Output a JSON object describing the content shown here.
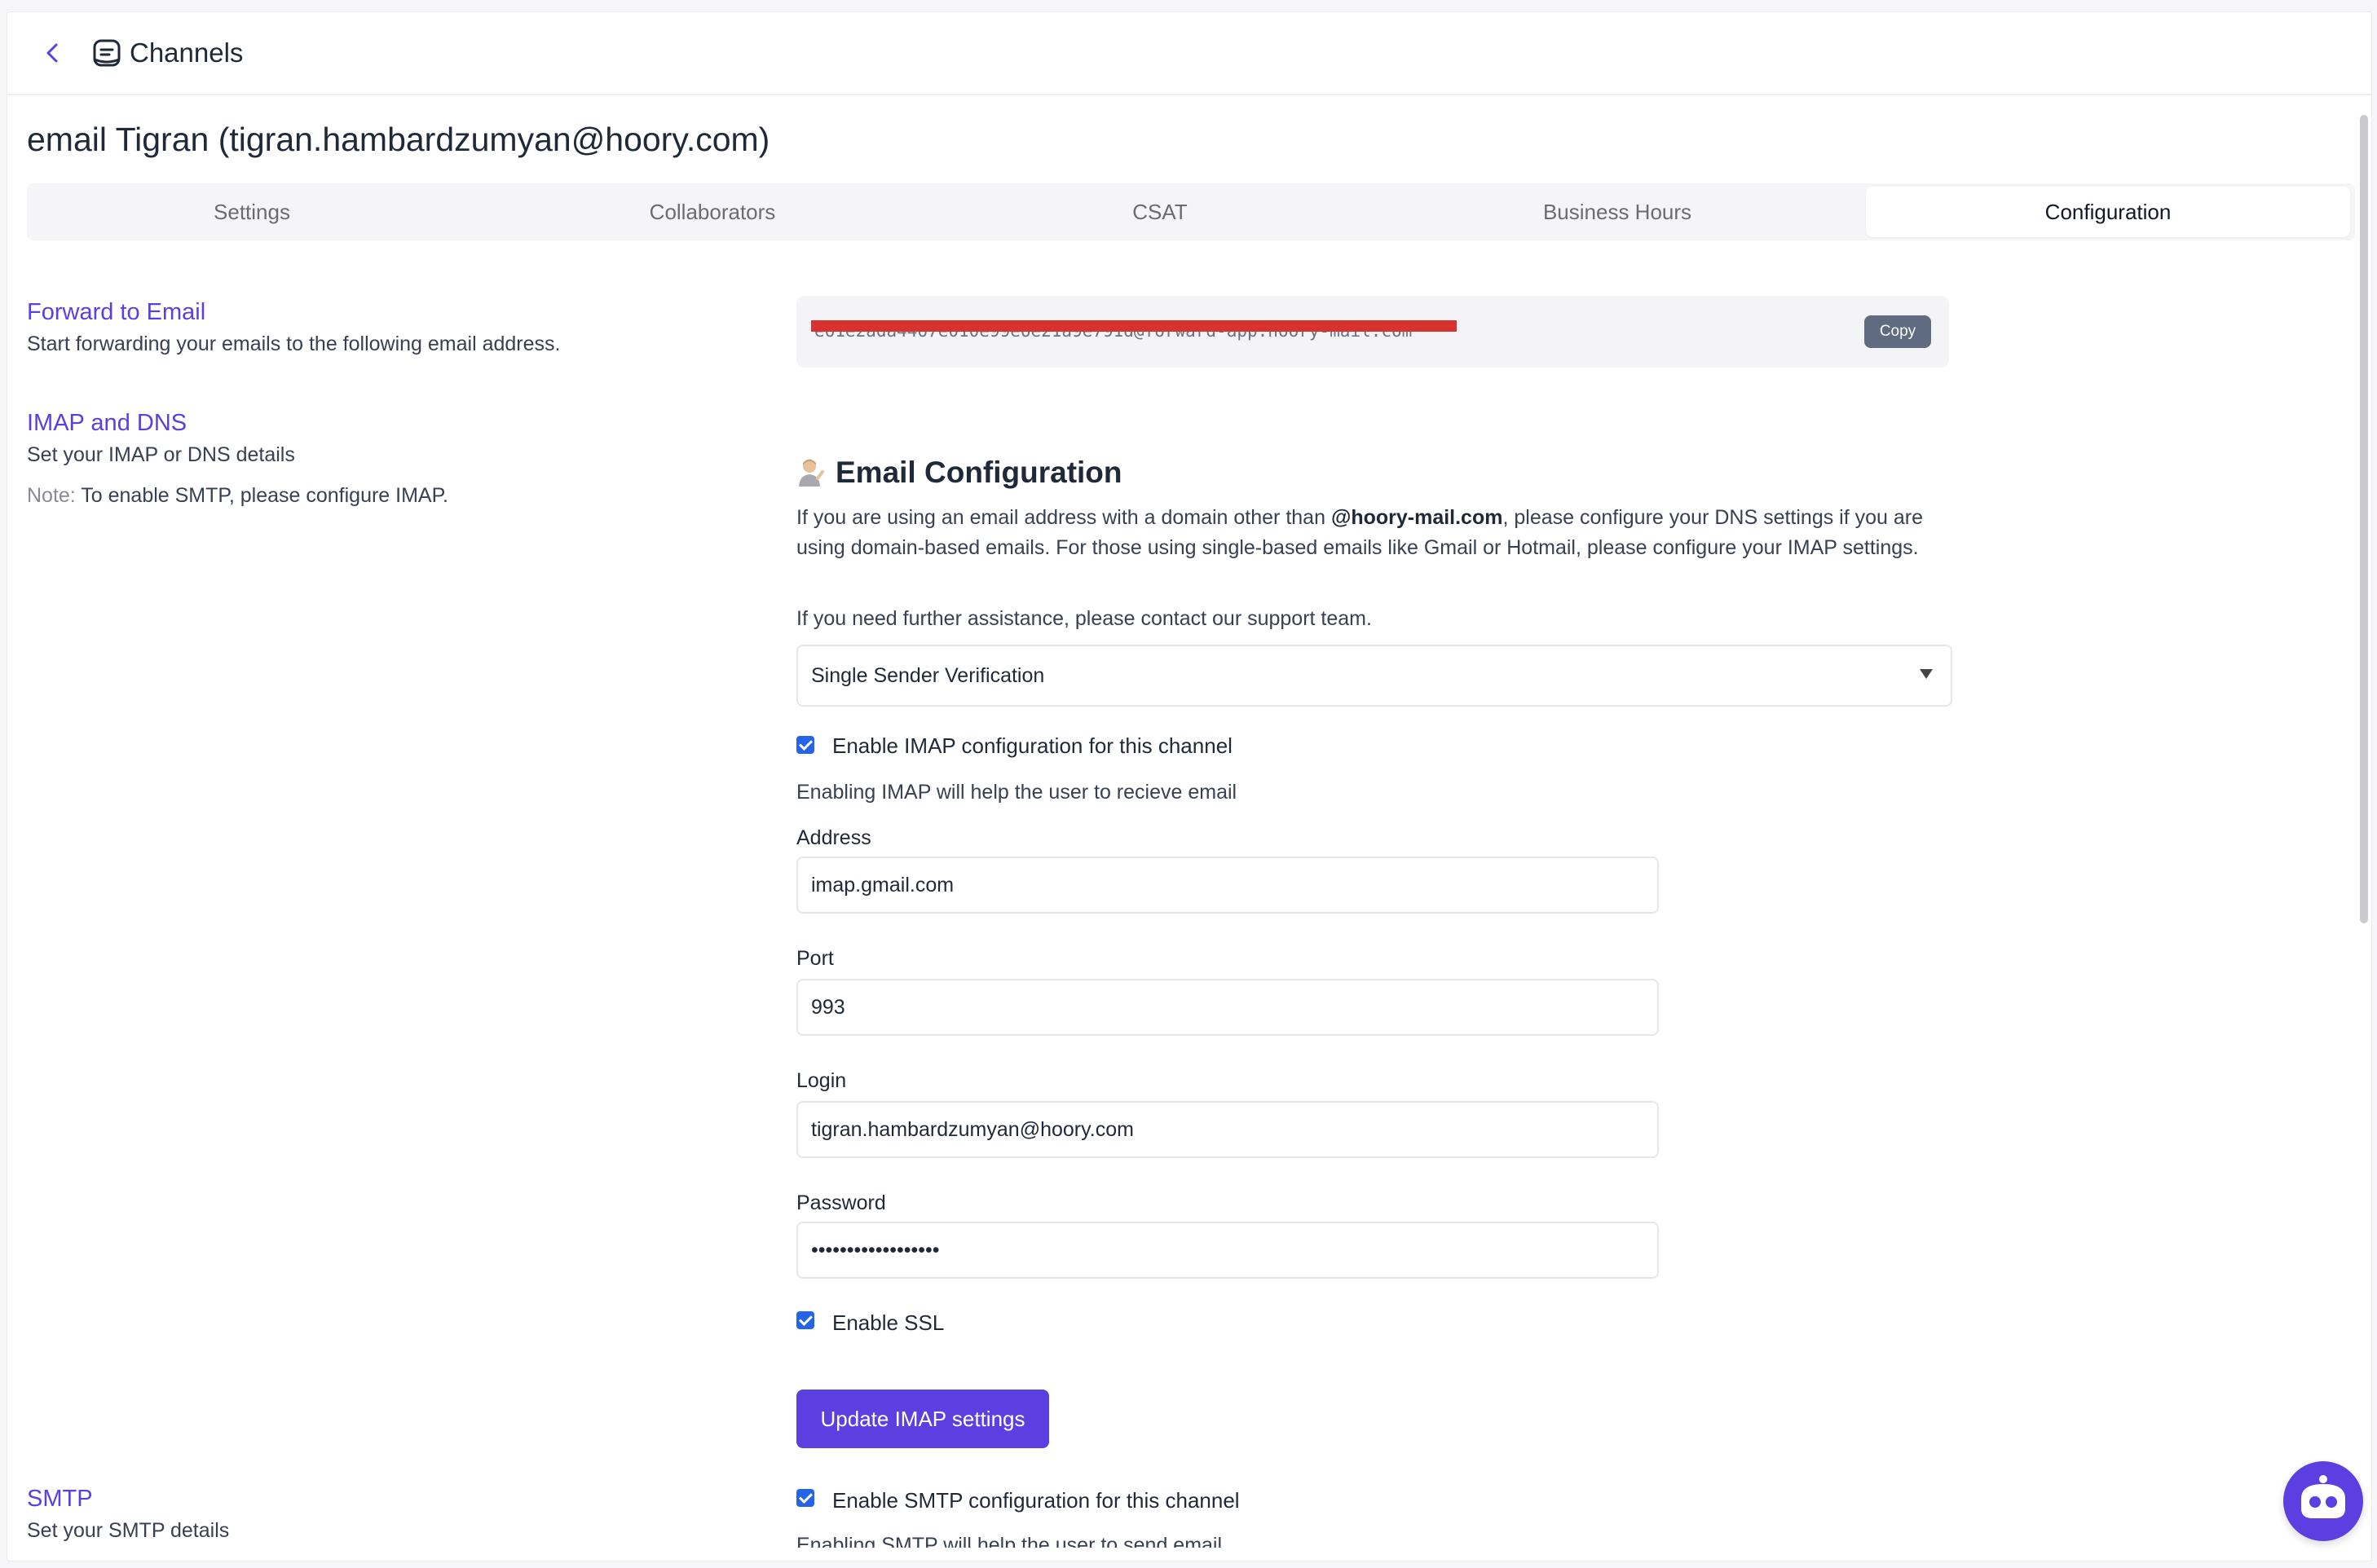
{
  "header": {
    "breadcrumb_title": "Channels"
  },
  "page": {
    "title": "email Tigran (tigran.hambardzumyan@hoory.com)"
  },
  "tabs": [
    {
      "label": "Settings",
      "active": false
    },
    {
      "label": "Collaborators",
      "active": false
    },
    {
      "label": "CSAT",
      "active": false
    },
    {
      "label": "Business Hours",
      "active": false
    },
    {
      "label": "Configuration",
      "active": true
    }
  ],
  "sidebar": {
    "forward": {
      "title": "Forward to Email",
      "desc": "Start forwarding your emails to the following email address."
    },
    "imap": {
      "title": "IMAP and DNS",
      "desc": "Set your IMAP or DNS details",
      "note_label": "Note:",
      "note_text": " To enable SMTP, please configure IMAP."
    },
    "smtp": {
      "title": "SMTP",
      "desc": "Set your SMTP details"
    }
  },
  "forward_box": {
    "email": "e61e2ada4467e010e99e6e21a9e791d@forward-app.hoory-mail.com",
    "copy_label": "Copy"
  },
  "email_config": {
    "heading": "Email Configuration",
    "para1_before": "If you are using an email address with a domain other than ",
    "para1_bold": "@hoory-mail.com",
    "para1_after": ", please configure your DNS settings if you are using domain-based emails. For those using single-based emails like Gmail or Hotmail, please configure your IMAP settings.",
    "para2": "If you need further assistance, please contact our support team.",
    "select_value": "Single Sender Verification"
  },
  "imap_form": {
    "enable_label": "Enable IMAP configuration for this channel",
    "enable_helper": "Enabling IMAP will help the user to recieve email",
    "address_label": "Address",
    "address_value": "imap.gmail.com",
    "port_label": "Port",
    "port_value": "993",
    "login_label": "Login",
    "login_value": "tigran.hambardzumyan@hoory.com",
    "password_label": "Password",
    "password_value": "••••••••••••••••••",
    "ssl_label": "Enable SSL",
    "update_label": "Update IMAP settings"
  },
  "smtp_form": {
    "enable_label": "Enable SMTP configuration for this channel",
    "enable_helper": "Enabling SMTP will help the user to send email"
  },
  "colors": {
    "accent": "#5b3fe0",
    "checkbox": "#2563eb",
    "redaction": "#d8322f"
  }
}
